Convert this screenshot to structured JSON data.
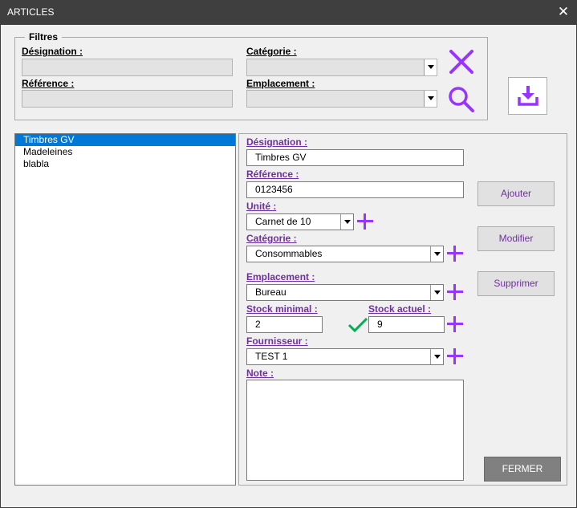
{
  "window": {
    "title": "ARTICLES",
    "close_glyph": "✕"
  },
  "filters": {
    "legend": "Filtres",
    "designation_label": "Désignation :",
    "categorie_label": "Catégorie :",
    "reference_label": "Référence :",
    "emplacement_label": "Emplacement :",
    "designation_value": "",
    "reference_value": "",
    "categorie_value": "",
    "emplacement_value": ""
  },
  "list": {
    "items": [
      "Timbres GV",
      "Madeleines",
      "blabla"
    ],
    "selected_index": 0
  },
  "form": {
    "designation_label": "Désignation :",
    "designation_value": "Timbres GV",
    "reference_label": "Référence :",
    "reference_value": "0123456",
    "unite_label": "Unité :",
    "unite_value": "Carnet de 10",
    "categorie_label": "Catégorie :",
    "categorie_value": "Consommables",
    "emplacement_label": "Emplacement :",
    "emplacement_value": "Bureau",
    "stock_min_label": "Stock minimal :",
    "stock_min_value": "2",
    "stock_actuel_label": "Stock actuel :",
    "stock_actuel_value": "9",
    "fournisseur_label": "Fournisseur :",
    "fournisseur_value": "TEST 1",
    "note_label": "Note :",
    "note_value": ""
  },
  "buttons": {
    "ajouter": "Ajouter",
    "modifier": "Modifier",
    "supprimer": "Supprimer",
    "fermer": "FERMER"
  },
  "icons": {
    "clear_filter": "close-x-icon",
    "search": "search-icon",
    "download": "download-icon",
    "add": "plus-icon",
    "check": "check-icon"
  },
  "colors": {
    "accent_purple": "#9933ff",
    "label_purple": "#7030a0",
    "check_green": "#00b050",
    "selection_blue": "#0078d7",
    "titlebar": "#3f3f3f"
  }
}
